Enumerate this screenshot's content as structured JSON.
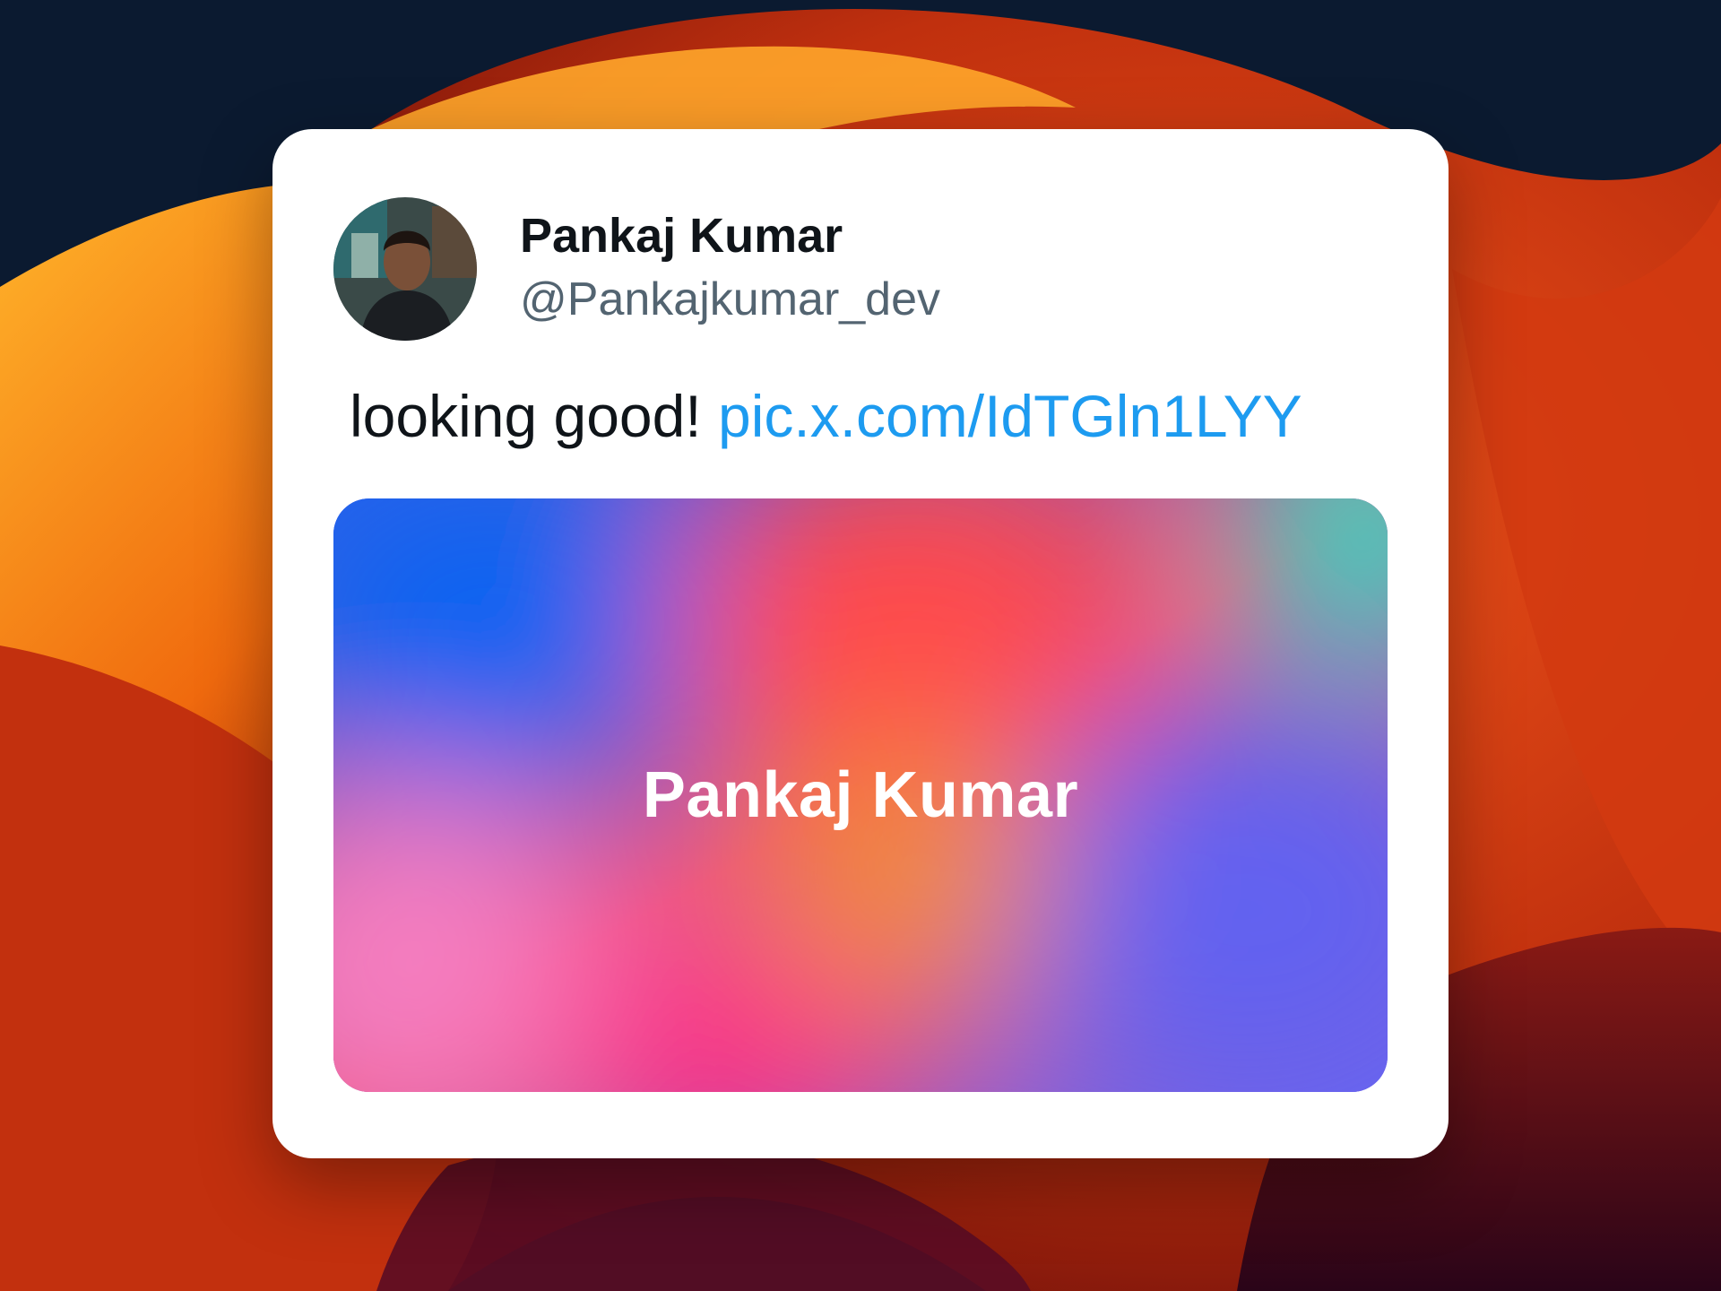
{
  "tweet": {
    "author_name": "Pankaj Kumar",
    "author_handle": "@Pankajkumar_dev",
    "text": "looking good!",
    "link": "pic.x.com/IdTGln1LYY",
    "media_caption": "Pankaj Kumar",
    "avatar_icon": "profile-photo"
  },
  "colors": {
    "background": "#0b1a30",
    "card": "#ffffff",
    "name": "#0f1419",
    "handle": "#536471",
    "link": "#1d9bf0"
  }
}
